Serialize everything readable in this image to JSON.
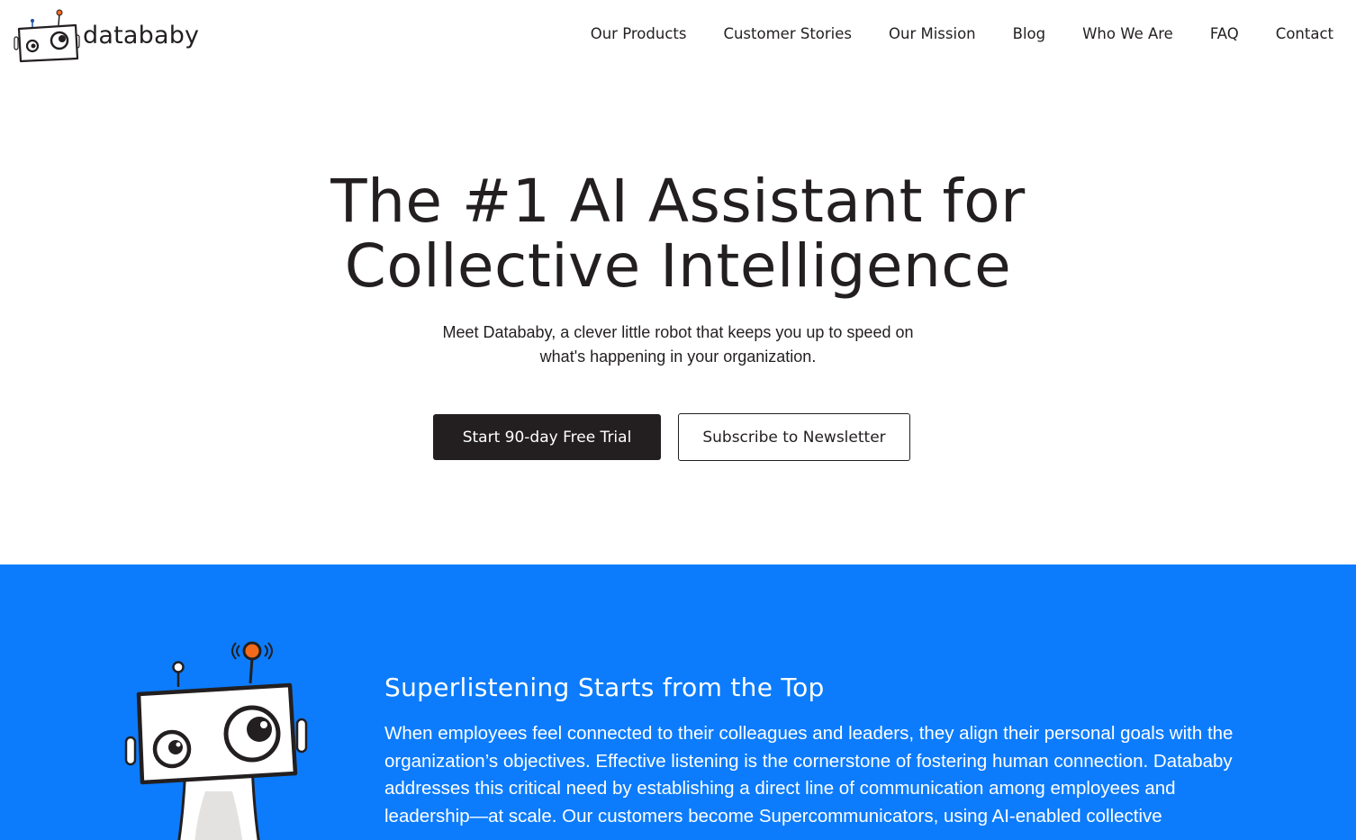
{
  "brand": {
    "name": "datababy"
  },
  "nav": {
    "items": [
      "Our Products",
      "Customer Stories",
      "Our Mission",
      "Blog",
      "Who We Are",
      "FAQ",
      "Contact"
    ]
  },
  "hero": {
    "title_line1": "The #1 AI Assistant for",
    "title_line2": "Collective Intelligence",
    "subtitle": "Meet Datababy, a clever little robot that keeps you up to speed on what's happening in your organization.",
    "primary_cta": "Start 90-day Free Trial",
    "secondary_cta": "Subscribe to Newsletter"
  },
  "section": {
    "heading": "Superlistening Starts from the Top",
    "body": "When employees feel connected to their colleagues and leaders, they align their personal goals with the organization’s objectives. Effective listening is the cornerstone of fostering human connection. Datababy addresses this critical need by establishing a direct line of communication among employees and leadership—at scale. Our customers become Supercommunicators, using AI-enabled collective"
  },
  "colors": {
    "text": "#231f20",
    "accent_blue": "#0c7cfc",
    "antenna_orange": "#f26b1d",
    "antenna_blue": "#1f4fa8"
  },
  "icons": [
    "datababy-logo-icon",
    "robot-mascot-icon"
  ]
}
